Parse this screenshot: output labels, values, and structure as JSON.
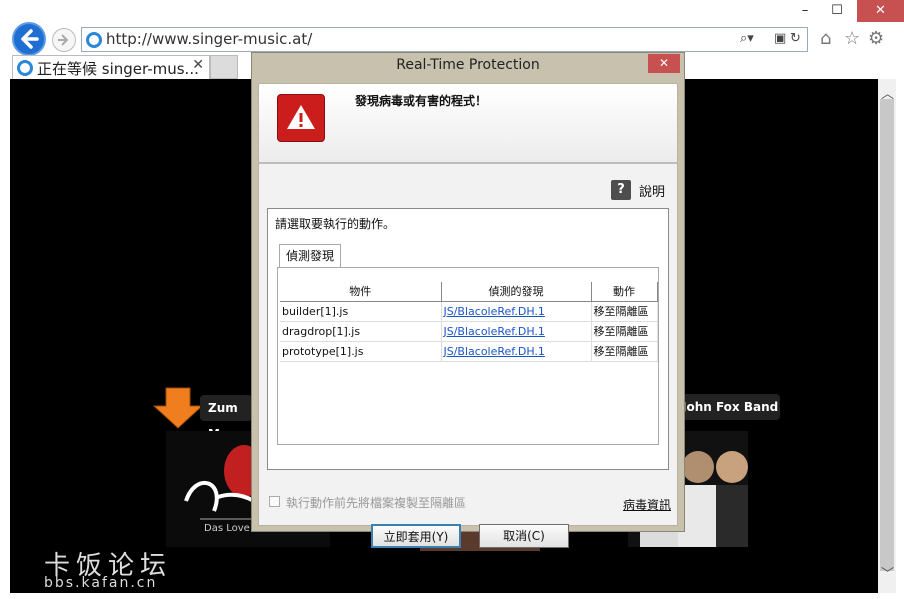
{
  "browser": {
    "url": "http://www.singer-music.at/",
    "tab_title": "正在等候 singer-mus...",
    "window_controls": [
      "–",
      "☐",
      "✕"
    ]
  },
  "page": {
    "buttons": [
      "Zum Mu",
      "John Fox Band"
    ],
    "album_left_text": "Das Love &",
    "watermark_cn": "卡饭论坛",
    "watermark_url": "bbs.kafan.cn"
  },
  "dialog": {
    "title": "Real-Time Protection",
    "header_message": "發現病毒或有害的程式！",
    "help_label": "說明",
    "prompt": "請選取要執行的動作。",
    "tab_label": "偵測發現",
    "columns": [
      "物件",
      "偵測的發現",
      "動作"
    ],
    "rows": [
      {
        "object": "builder[1].js",
        "detection": "JS/BlacoleRef.DH.1",
        "action": "移至隔離區"
      },
      {
        "object": "dragdrop[1].js",
        "detection": "JS/BlacoleRef.DH.1",
        "action": "移至隔離區"
      },
      {
        "object": "prototype[1].js",
        "detection": "JS/BlacoleRef.DH.1",
        "action": "移至隔離區"
      }
    ],
    "checkbox_label": "執行動作前先將檔案複製至隔離區",
    "virus_info_link": "病毒資訊",
    "apply_button": "立即套用(Y)",
    "cancel_button": "取消(C)"
  },
  "colors": {
    "warning_red": "#cc1d1d",
    "link_blue": "#1a56c8",
    "ie_blue": "#1f6fd2"
  }
}
